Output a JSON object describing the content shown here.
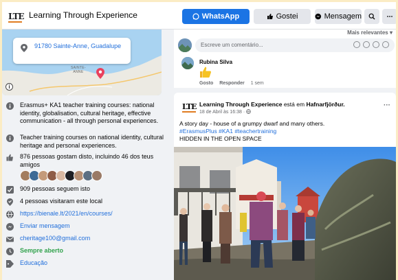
{
  "header": {
    "page_name": "Learning Through Experience",
    "whatsapp_label": "WhatsApp",
    "like_label": "Gostei",
    "message_label": "Mensagem"
  },
  "logo": {
    "text": "LTE"
  },
  "map": {
    "address": "91780 Sainte-Anne, Guadalupe",
    "map_label_line1": "SAINTE-",
    "map_label_line2": "ANNE"
  },
  "info": {
    "item1": "Erasmus+ KA1 teacher training courses: national identity, globalisation, cultural heritage, effective communication - all through personal experiences.",
    "item2": "Teacher training courses on national identity, cultural heritage and personal experiences.",
    "item3": "876 pessoas gostam disto, incluindo 46 dos teus amigos",
    "item4": "909 pessoas seguem isto",
    "item5": "4 pessoas visitaram este local",
    "item6": "https://bienale.lt/2021/en/courses/",
    "item7": "Enviar mensagem",
    "item8": "cheritage100@gmail.com",
    "item9": "Sempre aberto",
    "item10": "Educação"
  },
  "comments": {
    "sort_label": "Mais relevantes",
    "input_placeholder": "Escreve um comentário...",
    "commenter_name": "Rubina Silva",
    "like_action": "Gosto",
    "reply_action": "Responder",
    "time": "1 sem"
  },
  "post": {
    "author": "Learning Through Experience",
    "location_prefix": "está em",
    "location": "Hafnarfjörður.",
    "date": "18 de Abril às 16:38 ·",
    "line1": "A story day - house of a grumpy dwarf and many others.",
    "hashtags": "#ErasmusPlus #KA1 #teachertraining",
    "line3": "HIDDEN IN THE OPEN SPACE"
  },
  "colors": {
    "brand_blue": "#1b74e4",
    "link_blue": "#216fdb",
    "open_green": "#31a24c",
    "logo_orange": "#d8611c"
  }
}
